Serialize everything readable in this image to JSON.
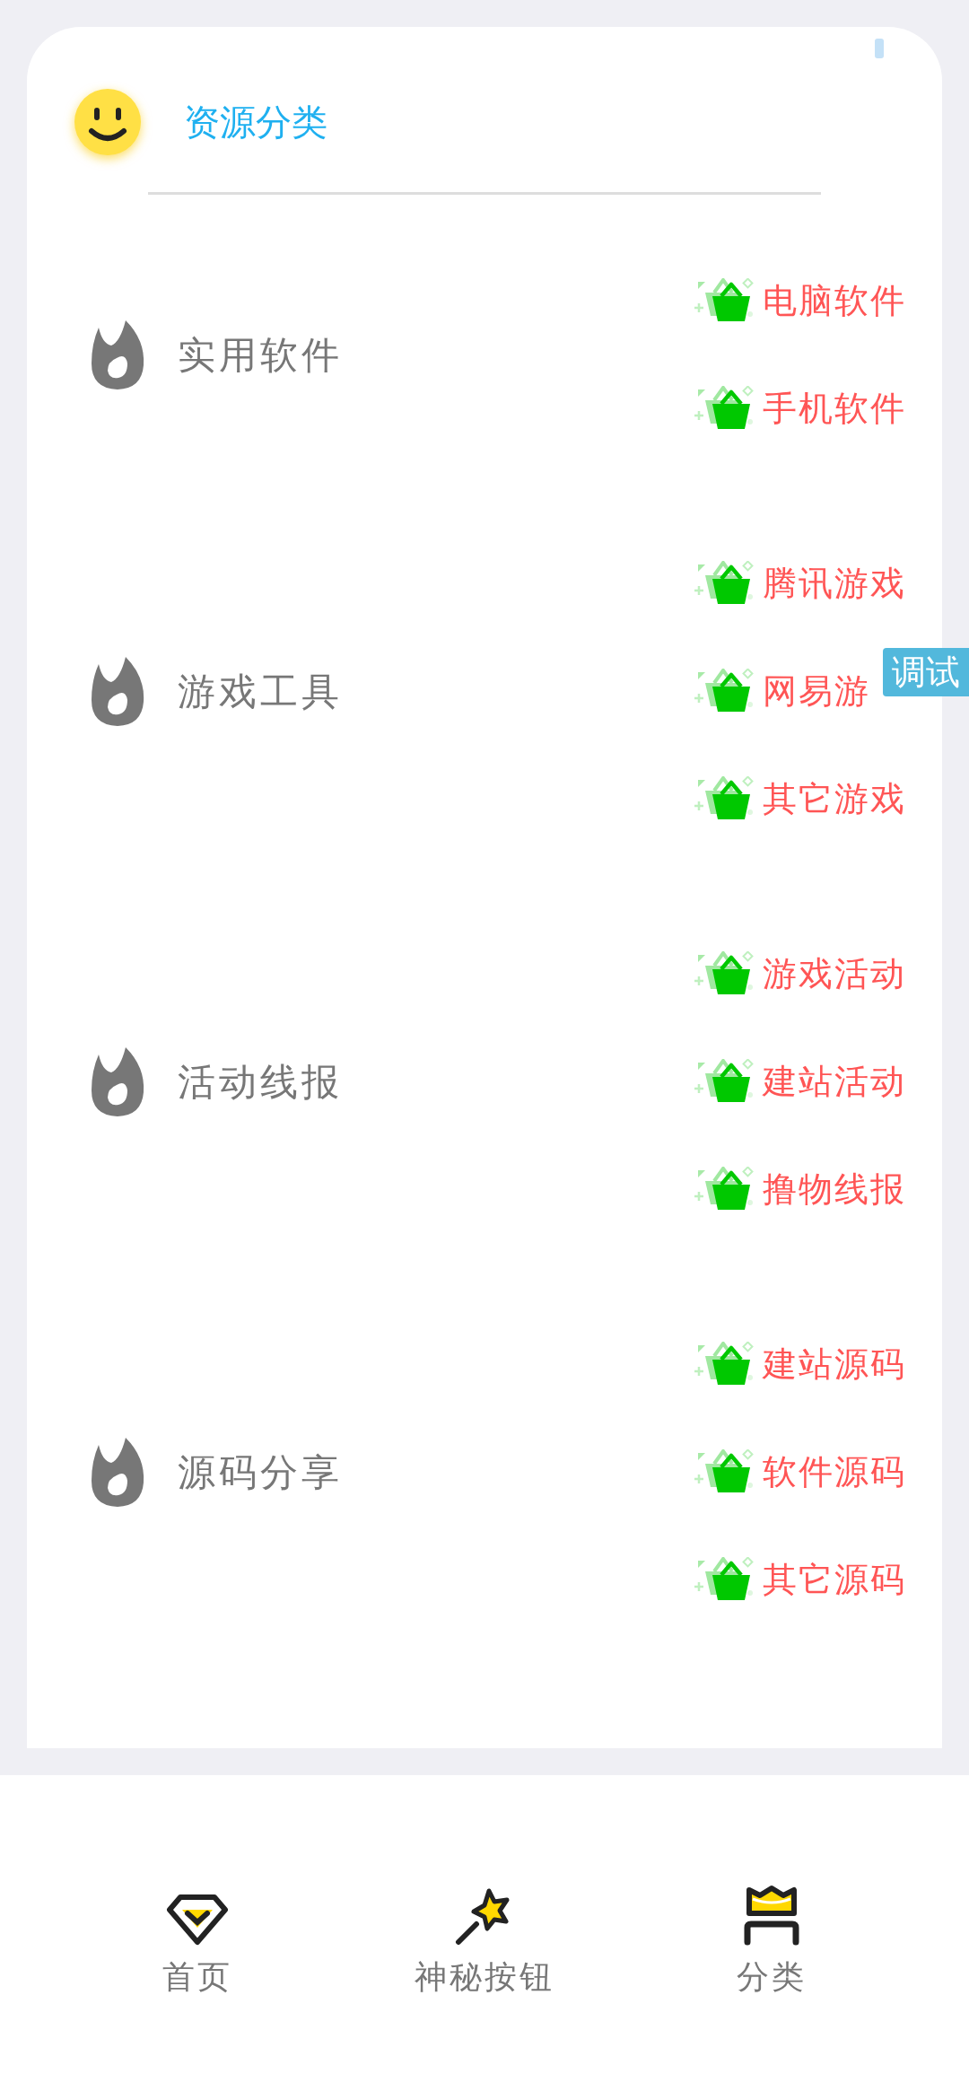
{
  "header": {
    "title": "资源分类"
  },
  "categories": [
    {
      "label": "实用软件",
      "items": [
        "电脑软件",
        "手机软件"
      ]
    },
    {
      "label": "游戏工具",
      "items": [
        "腾讯游戏",
        "网易游",
        "其它游戏"
      ]
    },
    {
      "label": "活动线报",
      "items": [
        "游戏活动",
        "建站活动",
        "撸物线报"
      ]
    },
    {
      "label": "源码分享",
      "items": [
        "建站源码",
        "软件源码",
        "其它源码"
      ]
    }
  ],
  "debug_tag": "调试",
  "bottom_nav": [
    {
      "kind": "diamond",
      "label": "首页"
    },
    {
      "kind": "wand",
      "label": "神秘按钮"
    },
    {
      "kind": "crown",
      "label": "分类"
    }
  ]
}
